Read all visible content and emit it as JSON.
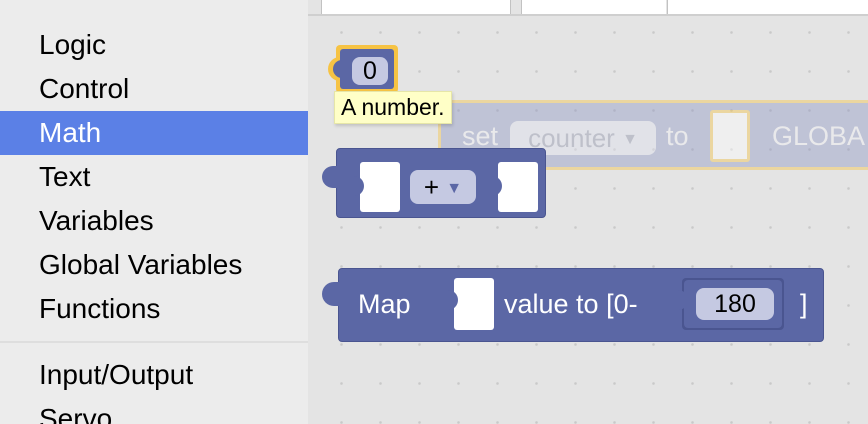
{
  "toolbox": {
    "categories": [
      {
        "label": "Logic"
      },
      {
        "label": "Control"
      },
      {
        "label": "Math",
        "selected": true
      },
      {
        "label": "Text"
      },
      {
        "label": "Variables"
      },
      {
        "label": "Global Variables"
      },
      {
        "label": "Functions"
      },
      {
        "label": "Input/Output"
      },
      {
        "label": "Servo"
      }
    ]
  },
  "workspace": {
    "number_block": {
      "value": "0",
      "tooltip": "A number."
    },
    "set_block": {
      "set_label": "set",
      "variable": "counter",
      "to_label": "to",
      "global_label": "GLOBA"
    },
    "arith_block": {
      "operator": "+"
    },
    "map_block": {
      "map_label": "Map",
      "value_label": "value to [0-",
      "number": "180",
      "close_label": "]"
    }
  },
  "colors": {
    "math_block": "#5b67a5",
    "selected_category": "#5b80e6",
    "selection_highlight": "#f6c344",
    "tooltip_bg": "#ffffc7"
  },
  "icons": [
    "dropdown-arrow-icon"
  ]
}
